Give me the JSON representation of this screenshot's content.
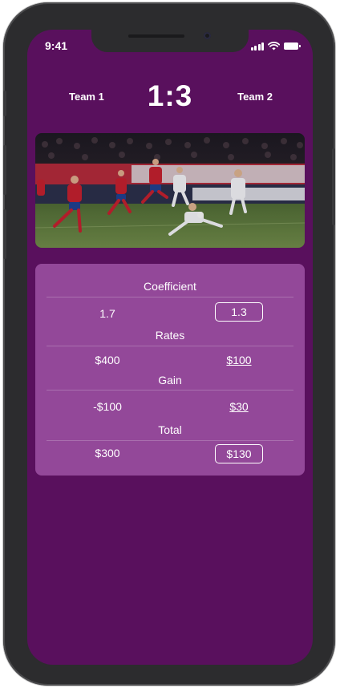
{
  "status_bar": {
    "time": "9:41"
  },
  "match": {
    "home_team": "Team 1",
    "away_team": "Team 2",
    "score": "1:3"
  },
  "bet": {
    "coefficient": {
      "label": "Coefficient",
      "left": "1.7",
      "right": "1.3"
    },
    "rates": {
      "label": "Rates",
      "left": "$400",
      "right": "$100"
    },
    "gain": {
      "label": "Gain",
      "left": "-$100",
      "right": "$30"
    },
    "total": {
      "label": "Total",
      "left": "$300",
      "right": "$130"
    }
  },
  "colors": {
    "screen_bg": "#59105d",
    "card_bg": "#934899",
    "text": "#ffffff"
  },
  "icons": [
    "signal-icon",
    "wifi-icon",
    "battery-icon"
  ]
}
